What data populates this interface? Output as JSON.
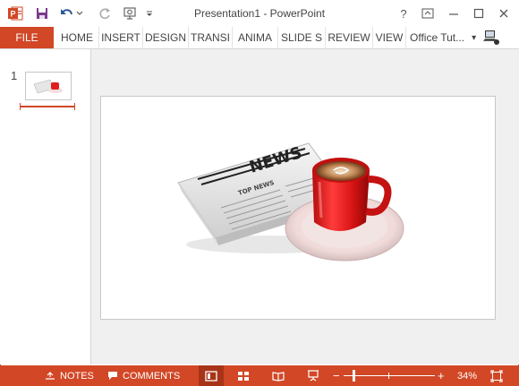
{
  "window": {
    "title": "Presentation1 - PowerPoint",
    "help": "?",
    "accent_color": "#d24726"
  },
  "qat": {
    "app_icon": "powerpoint-logo-icon",
    "app_icon_label": "P",
    "items": [
      "save-icon",
      "undo-icon",
      "redo-icon",
      "start-from-beginning-icon",
      "customize-qat-icon"
    ]
  },
  "ribbon": {
    "file_label": "FILE",
    "tabs": [
      "HOME",
      "INSERT",
      "DESIGN",
      "TRANSI",
      "ANIMA",
      "SLIDE S",
      "REVIEW",
      "VIEW"
    ],
    "account_name": "Office Tut...",
    "account_dropdown": "▾"
  },
  "thumbnails": {
    "slide_number": "1"
  },
  "slide": {
    "image_description_icon": "news-coffee-image",
    "newspaper_masthead": "NEWS",
    "newspaper_subhead": "TOP NEWS"
  },
  "statusbar": {
    "notes_label": "NOTES",
    "comments_label": "COMMENTS",
    "zoom_minus": "−",
    "zoom_plus": "+",
    "zoom_level": "34%",
    "zoom_fraction": 0.34
  }
}
